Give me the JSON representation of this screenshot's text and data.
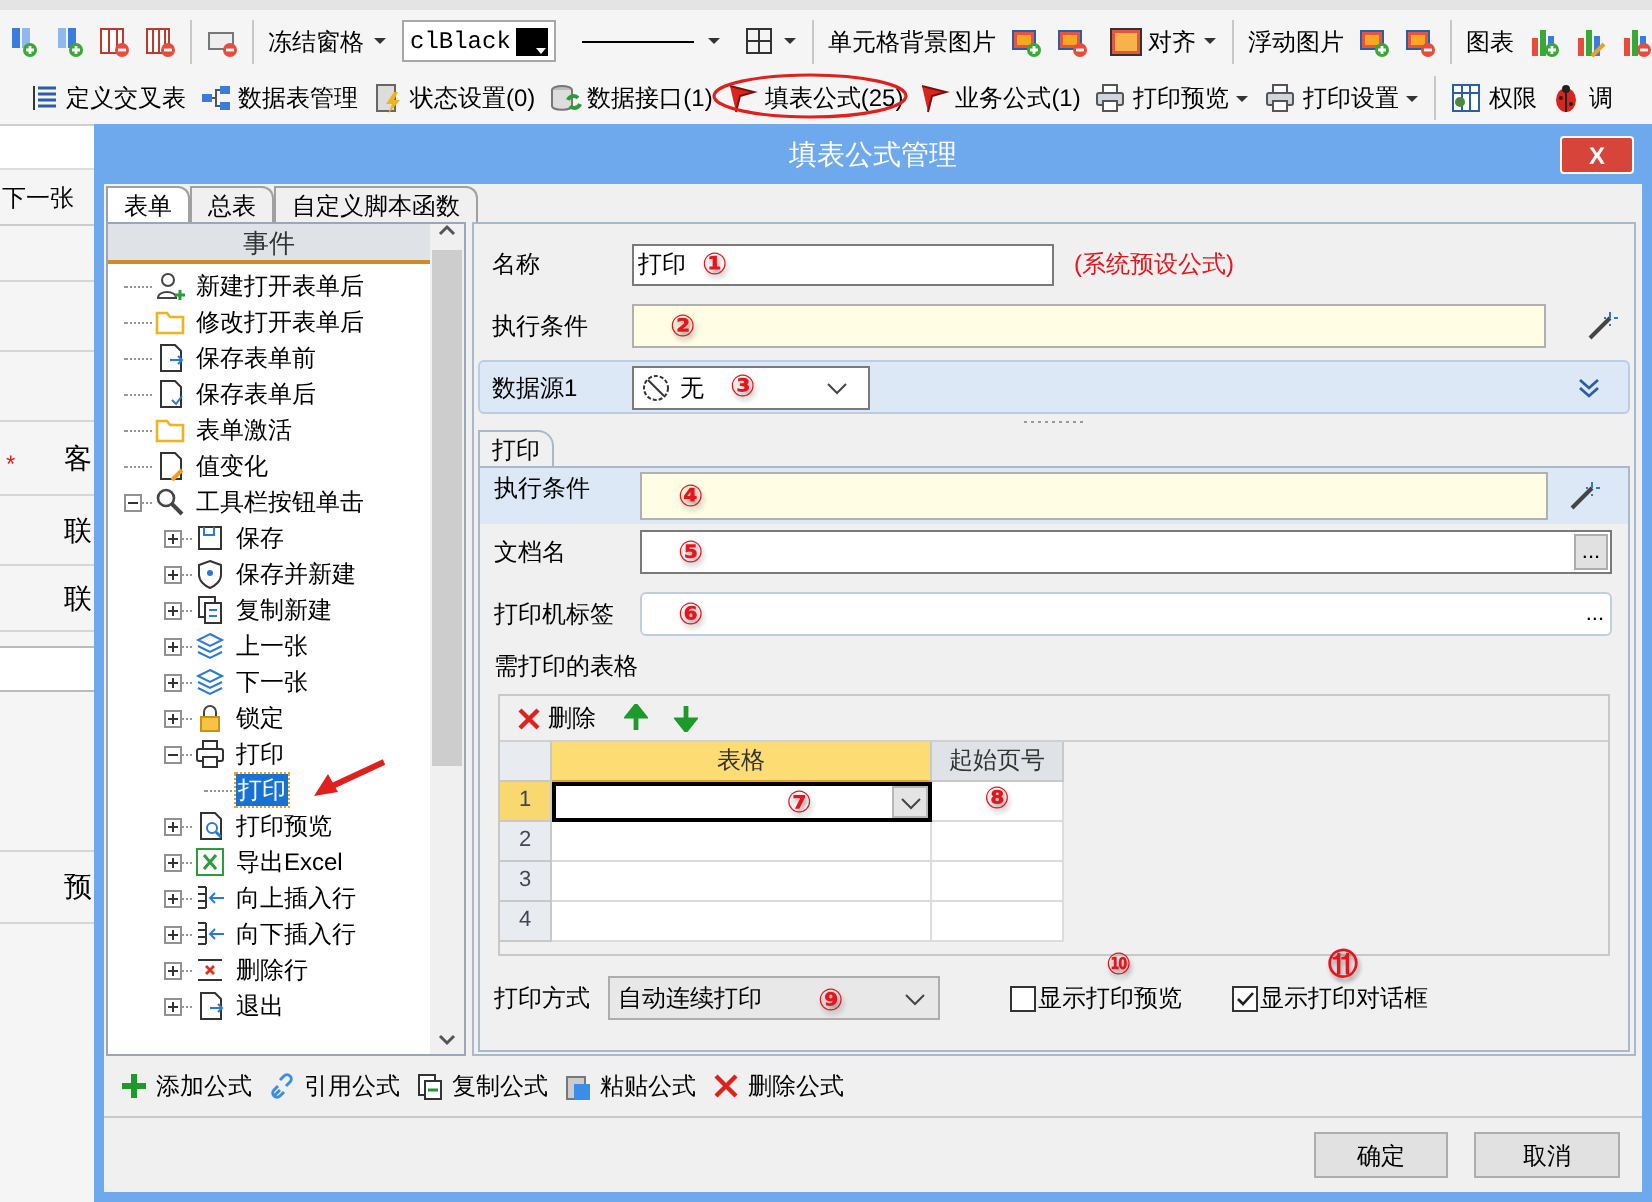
{
  "toolbar_top": {
    "freeze_panes": "冻结窗格",
    "color_value": "clBlack",
    "cell_background": "单元格背景图片",
    "align": "对齐",
    "floating_image": "浮动图片",
    "chart": "图表"
  },
  "toolbar_main": [
    {
      "label": "定义交叉表",
      "circled": false,
      "dropdown": false
    },
    {
      "label": "数据表管理",
      "circled": false,
      "dropdown": false
    },
    {
      "label": "状态设置(0)",
      "circled": false,
      "dropdown": false
    },
    {
      "label": "数据接口(1)",
      "circled": false,
      "dropdown": false
    },
    {
      "label": "填表公式(25)",
      "circled": true,
      "dropdown": false
    },
    {
      "label": "业务公式(1)",
      "circled": false,
      "dropdown": false
    },
    {
      "label": "打印预览",
      "circled": false,
      "dropdown": true
    },
    {
      "label": "打印设置",
      "circled": false,
      "dropdown": true
    },
    {
      "label": "权限",
      "circled": false,
      "dropdown": false
    },
    {
      "label": "调",
      "circled": false,
      "dropdown": false
    }
  ],
  "background_sheet": {
    "next_button": "下一张",
    "labels": [
      {
        "text": "客",
        "mark": "*"
      },
      {
        "text": "联"
      },
      {
        "text": "联"
      },
      {
        "text": "预"
      }
    ]
  },
  "dialog": {
    "title": "填表公式管理",
    "close": "X",
    "tabs": [
      {
        "label": "表单",
        "selected": true
      },
      {
        "label": "总表",
        "selected": false
      },
      {
        "label": "自定义脚本函数",
        "selected": false
      }
    ],
    "events": {
      "header": "事件",
      "items": [
        {
          "label": "新建打开表单后",
          "selected": false
        },
        {
          "label": "修改打开表单后",
          "selected": false
        },
        {
          "label": "保存表单前",
          "selected": false
        },
        {
          "label": "保存表单后",
          "selected": false
        },
        {
          "label": "表单激活",
          "selected": false
        },
        {
          "label": "值变化",
          "selected": false
        },
        {
          "label": "工具栏按钮单击",
          "selected": false,
          "expanded": true,
          "children": [
            {
              "label": "保存",
              "selected": false,
              "expanded": false
            },
            {
              "label": "保存并新建",
              "selected": false,
              "expanded": false
            },
            {
              "label": "复制新建",
              "selected": false,
              "expanded": false
            },
            {
              "label": "上一张",
              "selected": false,
              "expanded": false
            },
            {
              "label": "下一张",
              "selected": false,
              "expanded": false
            },
            {
              "label": "锁定",
              "selected": false,
              "expanded": false
            },
            {
              "label": "打印",
              "selected": false,
              "expanded": true,
              "children": [
                {
                  "label": "打印",
                  "selected": true
                }
              ]
            },
            {
              "label": "打印预览",
              "selected": false,
              "expanded": false
            },
            {
              "label": "导出Excel",
              "selected": false,
              "expanded": false
            },
            {
              "label": "向上插入行",
              "selected": false,
              "expanded": false
            },
            {
              "label": "向下插入行",
              "selected": false,
              "expanded": false
            },
            {
              "label": "删除行",
              "selected": false,
              "expanded": false
            },
            {
              "label": "退出",
              "selected": false,
              "expanded": false
            }
          ]
        }
      ]
    },
    "formula": {
      "name": {
        "label": "名称",
        "value": "打印",
        "marker": "①",
        "note": "(系统预设公式)"
      },
      "condition": {
        "label": "执行条件",
        "marker": "②"
      },
      "data_source": {
        "label": "数据源1",
        "value": "无",
        "marker": "③"
      },
      "print": {
        "tab": {
          "label": "打印",
          "selected": true
        },
        "condition": {
          "label": "执行条件",
          "marker": "④"
        },
        "document_name": {
          "label": "文档名",
          "marker": "⑤",
          "browse": "..."
        },
        "printer_tag": {
          "label": "打印机标签",
          "marker": "⑥",
          "browse": "..."
        },
        "tables": {
          "label": "需打印的表格",
          "delete": "删除",
          "columns": [
            {
              "label": "表格",
              "selected": true
            },
            {
              "label": "起始页号",
              "selected": false
            }
          ],
          "rows": [
            {
              "number": "1",
              "selected": true,
              "table_marker": "⑦",
              "page_marker": "⑧"
            },
            {
              "number": "2",
              "selected": false
            },
            {
              "number": "3",
              "selected": false
            },
            {
              "number": "4",
              "selected": false
            }
          ]
        },
        "print_mode": {
          "label": "打印方式",
          "value": "自动连续打印",
          "marker": "⑨"
        },
        "options": [
          {
            "label": "显示打印预览",
            "checked": false,
            "marker": "⑩"
          },
          {
            "label": "显示打印对话框",
            "checked": true,
            "marker": "⑪"
          }
        ]
      }
    },
    "actions": [
      "添加公式",
      "引用公式",
      "复制公式",
      "粘贴公式",
      "删除公式"
    ],
    "buttons": [
      "确定",
      "取消"
    ]
  }
}
